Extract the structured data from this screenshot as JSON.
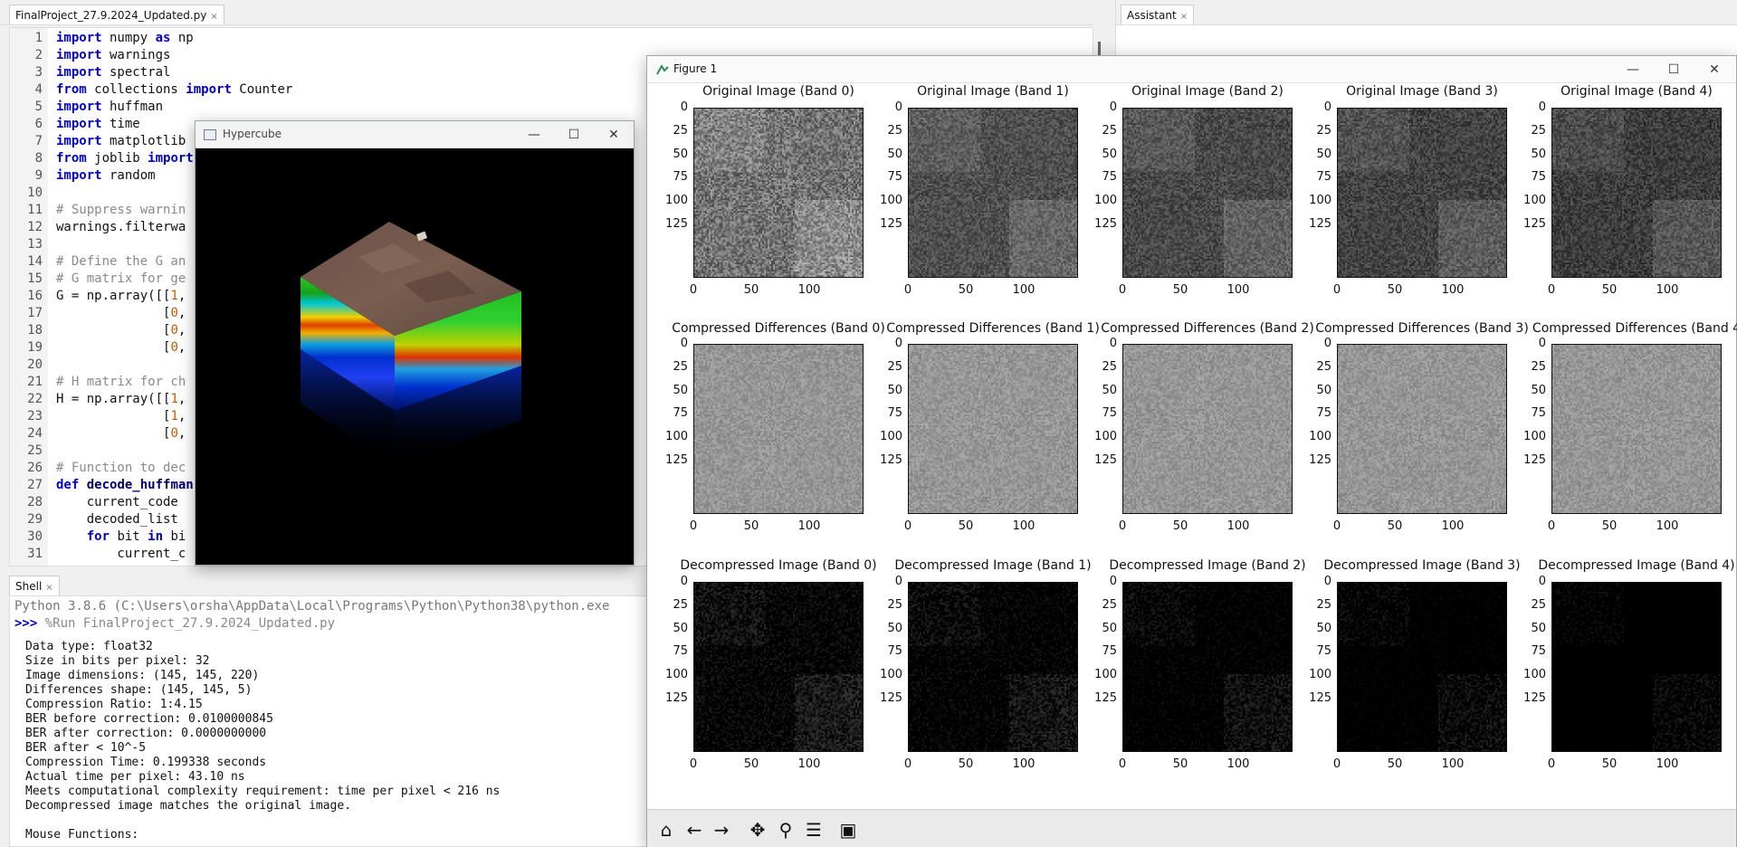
{
  "editor": {
    "tab_label": "FinalProject_27.9.2024_Updated.py",
    "tab_close": "×",
    "lines": [
      {
        "n": "1",
        "parts": [
          {
            "t": "import",
            "c": "kw"
          },
          {
            "t": " numpy "
          },
          {
            "t": "as",
            "c": "kw"
          },
          {
            "t": " np"
          }
        ]
      },
      {
        "n": "2",
        "parts": [
          {
            "t": "import",
            "c": "kw"
          },
          {
            "t": " warnings"
          }
        ]
      },
      {
        "n": "3",
        "parts": [
          {
            "t": "import",
            "c": "kw"
          },
          {
            "t": " spectral"
          }
        ]
      },
      {
        "n": "4",
        "parts": [
          {
            "t": "from",
            "c": "kw"
          },
          {
            "t": " collections "
          },
          {
            "t": "import",
            "c": "kw"
          },
          {
            "t": " Counter"
          }
        ]
      },
      {
        "n": "5",
        "parts": [
          {
            "t": "import",
            "c": "kw"
          },
          {
            "t": " huffman"
          }
        ]
      },
      {
        "n": "6",
        "parts": [
          {
            "t": "import",
            "c": "kw"
          },
          {
            "t": " time"
          }
        ]
      },
      {
        "n": "7",
        "parts": [
          {
            "t": "import",
            "c": "kw"
          },
          {
            "t": " matplotlib"
          }
        ]
      },
      {
        "n": "8",
        "parts": [
          {
            "t": "from",
            "c": "kw"
          },
          {
            "t": " joblib "
          },
          {
            "t": "import",
            "c": "kw"
          }
        ]
      },
      {
        "n": "9",
        "parts": [
          {
            "t": "import",
            "c": "kw"
          },
          {
            "t": " random"
          }
        ]
      },
      {
        "n": "10",
        "parts": []
      },
      {
        "n": "11",
        "parts": [
          {
            "t": "# Suppress warnin",
            "c": "cm"
          }
        ]
      },
      {
        "n": "12",
        "parts": [
          {
            "t": "warnings.filterwa"
          }
        ]
      },
      {
        "n": "13",
        "parts": []
      },
      {
        "n": "14",
        "parts": [
          {
            "t": "# Define the G an",
            "c": "cm"
          }
        ]
      },
      {
        "n": "15",
        "parts": [
          {
            "t": "# G matrix for ge",
            "c": "cm"
          }
        ]
      },
      {
        "n": "16",
        "parts": [
          {
            "t": "G = np.array([["
          },
          {
            "t": "1",
            "c": "nm"
          },
          {
            "t": ","
          }
        ]
      },
      {
        "n": "17",
        "parts": [
          {
            "t": "              ["
          },
          {
            "t": "0",
            "c": "nm"
          },
          {
            "t": ","
          }
        ]
      },
      {
        "n": "18",
        "parts": [
          {
            "t": "              ["
          },
          {
            "t": "0",
            "c": "nm"
          },
          {
            "t": ","
          }
        ]
      },
      {
        "n": "19",
        "parts": [
          {
            "t": "              ["
          },
          {
            "t": "0",
            "c": "nm"
          },
          {
            "t": ","
          }
        ]
      },
      {
        "n": "20",
        "parts": []
      },
      {
        "n": "21",
        "parts": [
          {
            "t": "# H matrix for ch",
            "c": "cm"
          }
        ]
      },
      {
        "n": "22",
        "parts": [
          {
            "t": "H = np.array([["
          },
          {
            "t": "1",
            "c": "nm"
          },
          {
            "t": ","
          }
        ]
      },
      {
        "n": "23",
        "parts": [
          {
            "t": "              ["
          },
          {
            "t": "1",
            "c": "nm"
          },
          {
            "t": ","
          }
        ]
      },
      {
        "n": "24",
        "parts": [
          {
            "t": "              ["
          },
          {
            "t": "0",
            "c": "nm"
          },
          {
            "t": ","
          }
        ]
      },
      {
        "n": "25",
        "parts": []
      },
      {
        "n": "26",
        "parts": [
          {
            "t": "# Function to dec",
            "c": "cm"
          }
        ]
      },
      {
        "n": "27",
        "parts": [
          {
            "t": "def",
            "c": "kw"
          },
          {
            "t": " "
          },
          {
            "t": "decode_huffman",
            "c": "fn"
          }
        ]
      },
      {
        "n": "28",
        "parts": [
          {
            "t": "    current_code "
          }
        ]
      },
      {
        "n": "29",
        "parts": [
          {
            "t": "    decoded_list "
          }
        ]
      },
      {
        "n": "30",
        "parts": [
          {
            "t": "    "
          },
          {
            "t": "for",
            "c": "kw"
          },
          {
            "t": " bit "
          },
          {
            "t": "in",
            "c": "kw"
          },
          {
            "t": " bi"
          }
        ]
      },
      {
        "n": "31",
        "parts": [
          {
            "t": "        current_c"
          }
        ]
      }
    ]
  },
  "assistant": {
    "tab_label": "Assistant",
    "tab_close": "×"
  },
  "shell": {
    "tab_label": "Shell",
    "tab_close": "×",
    "python_line": "Python 3.8.6 (C:\\Users\\orsha\\AppData\\Local\\Programs\\Python\\Python38\\python.exe",
    "prompt": ">>>",
    "run_cmd": " %Run FinalProject_27.9.2024_Updated.py",
    "output": [
      "Data type: float32",
      "Size in bits per pixel: 32",
      "Image dimensions: (145, 145, 220)",
      "Differences shape: (145, 145, 5)",
      "Compression Ratio: 1:4.15",
      "BER before correction: 0.0100000845",
      "BER after correction: 0.0000000000",
      "BER after < 10^-5",
      "Compression Time: 0.199338 seconds",
      "Actual time per pixel: 43.10 ns",
      "Meets computational complexity requirement: time per pixel < 216 ns",
      "Decompressed image matches the original image.",
      "",
      "Mouse Functions:"
    ]
  },
  "hypercube": {
    "title": "Hypercube",
    "min_label": "—",
    "max_label": "☐",
    "close_label": "✕"
  },
  "figure": {
    "title": "Figure 1",
    "min_label": "—",
    "max_label": "☐",
    "close_label": "✕",
    "rows": [
      {
        "kind": "original",
        "titles": [
          "Original Image (Band 0)",
          "Original Image (Band 1)",
          "Original Image (Band 2)",
          "Original Image (Band 3)",
          "Original Image (Band 4)"
        ]
      },
      {
        "kind": "diff",
        "titles": [
          "Compressed Differences (Band 0)",
          "Compressed Differences (Band 1)",
          "Compressed Differences (Band 2)",
          "Compressed Differences (Band 3)",
          "Compressed Differences (Band 4"
        ]
      },
      {
        "kind": "decomp",
        "titles": [
          "Decompressed Image (Band 0)",
          "Decompressed Image (Band 1)",
          "Decompressed Image (Band 2)",
          "Decompressed Image (Band 3)",
          "Decompressed Image (Band 4)"
        ]
      }
    ],
    "yticks": [
      "0",
      "25",
      "50",
      "75",
      "100",
      "125"
    ],
    "xticks": [
      "0",
      "50",
      "100"
    ],
    "toolbar": [
      {
        "name": "home-icon",
        "glyph": "⌂"
      },
      {
        "name": "back-arrow-icon",
        "glyph": "←"
      },
      {
        "name": "forward-arrow-icon",
        "glyph": "→"
      },
      {
        "name": "pan-move-icon",
        "glyph": "✥"
      },
      {
        "name": "zoom-magnifier-icon",
        "glyph": "⚲"
      },
      {
        "name": "configure-subplots-icon",
        "glyph": "☰"
      },
      {
        "name": "save-figure-icon",
        "glyph": "▣"
      }
    ]
  }
}
